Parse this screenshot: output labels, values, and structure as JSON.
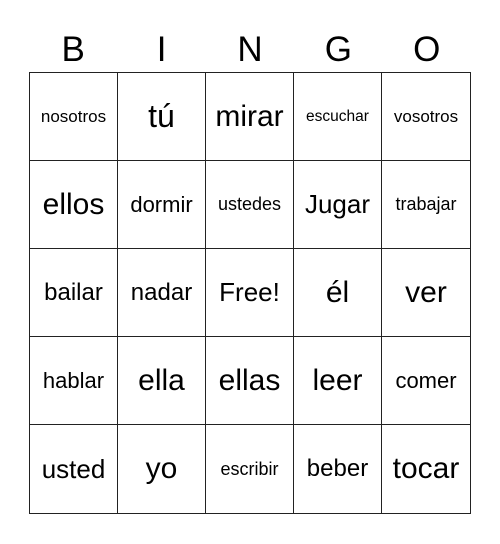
{
  "header": [
    "B",
    "I",
    "N",
    "G",
    "O"
  ],
  "cells": [
    "nosotros",
    "tú",
    "mirar",
    "escuchar",
    "vosotros",
    "ellos",
    "dormir",
    "ustedes",
    "Jugar",
    "trabajar",
    "bailar",
    "nadar",
    "Free!",
    "él",
    "ver",
    "hablar",
    "ella",
    "ellas",
    "leer",
    "comer",
    "usted",
    "yo",
    "escribir",
    "beber",
    "tocar"
  ]
}
